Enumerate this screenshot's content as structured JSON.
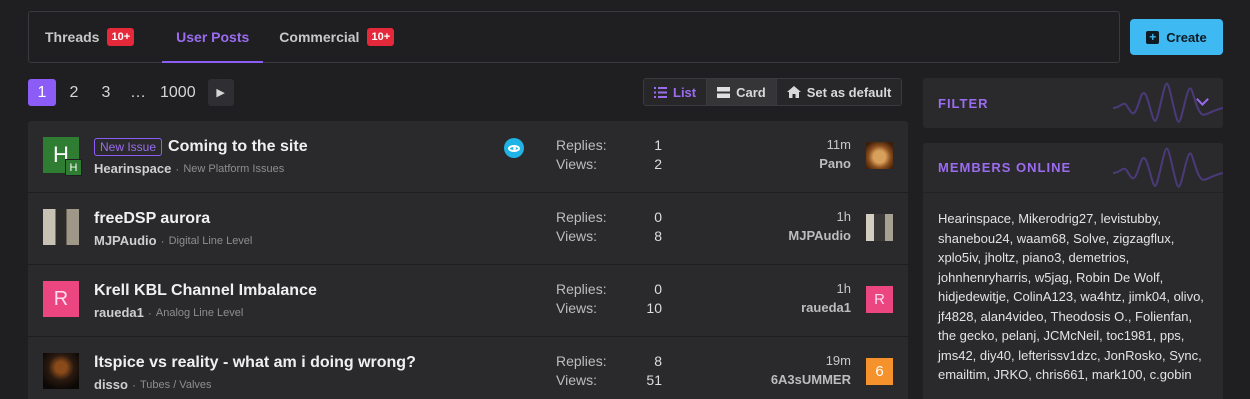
{
  "tabs": [
    {
      "label": "Threads",
      "badge": "10+"
    },
    {
      "label": "User Posts"
    },
    {
      "label": "Commercial",
      "badge": "10+"
    }
  ],
  "create_label": "Create",
  "pagination": {
    "pages": [
      "1",
      "2",
      "3",
      "…",
      "1000"
    ],
    "current": "1"
  },
  "views": {
    "list": "List",
    "card": "Card",
    "default": "Set as default"
  },
  "threads": [
    {
      "tag": "New Issue",
      "title": "Coming to the site",
      "author": "Hearinspace",
      "forum": "New Platform Issues",
      "replies_label": "Replies:",
      "replies": "1",
      "views_label": "Views:",
      "views": "2",
      "time": "11m",
      "last_user": "Pano",
      "avatar_letter": "H",
      "avatar_sub": "H"
    },
    {
      "title": "freeDSP aurora",
      "author": "MJPAudio",
      "forum": "Digital Line Level",
      "replies_label": "Replies:",
      "replies": "0",
      "views_label": "Views:",
      "views": "8",
      "time": "1h",
      "last_user": "MJPAudio"
    },
    {
      "title": "Krell KBL Channel Imbalance",
      "author": "raueda1",
      "forum": "Analog Line Level",
      "replies_label": "Replies:",
      "replies": "0",
      "views_label": "Views:",
      "views": "10",
      "time": "1h",
      "last_user": "raueda1",
      "avatar_letter": "R",
      "last_avatar_letter": "R"
    },
    {
      "title": "ltspice vs reality - what am i doing wrong?",
      "author": "disso",
      "forum": "Tubes / Valves",
      "replies_label": "Replies:",
      "replies": "8",
      "views_label": "Views:",
      "views": "51",
      "time": "19m",
      "last_user": "6A3sUMMER",
      "last_avatar_letter": "6"
    }
  ],
  "sidebar": {
    "filter_title": "FILTER",
    "members_title": "MEMBERS ONLINE",
    "members_text": "Hearinspace, Mikerodrig27, levistubby, shanebou24, waam68, Solve, zigzagflux, xplo5iv, jholtz, piano3, demetrios, johnhenryharris, w5jag, Robin De Wolf, hidjedewitje, ColinA123, wa4htz, jimk04, olivo, jf4828, alan4video, Theodosis O., Folienfan, the gecko, pelanj, JCMcNeil, toc1981, pps, jms42, diy40, lefterissv1dzc, JonRosko, Sync, emailtim, JRKO, chris661, mark100, c.gobin"
  },
  "colors": {
    "accent": "#8b5cf6",
    "badge": "#e5283a",
    "create": "#3fb9f1"
  }
}
